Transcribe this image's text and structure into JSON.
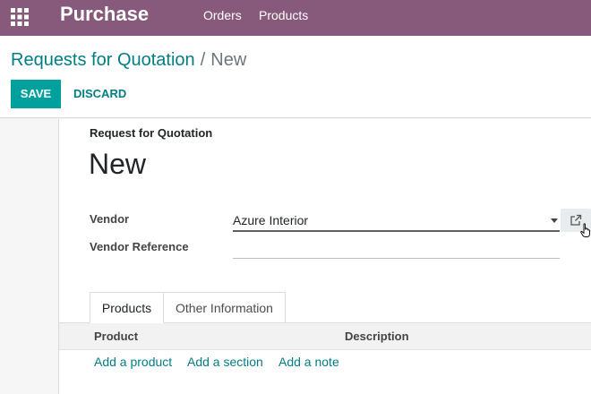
{
  "topbar": {
    "apps_icon": "grid-icon",
    "app_name": "Purchase",
    "menu": [
      "Orders",
      "Products"
    ]
  },
  "control_panel": {
    "breadcrumb": {
      "parent": "Requests for Quotation",
      "separator": "/",
      "current": "New"
    },
    "save_label": "SAVE",
    "discard_label": "DISCARD"
  },
  "form": {
    "doc_type_label": "Request for Quotation",
    "doc_name": "New",
    "fields": {
      "vendor_label": "Vendor",
      "vendor_value": "Azure Interior",
      "vendor_ref_label": "Vendor Reference",
      "vendor_ref_value": ""
    },
    "external_link_icon": "external-link-icon",
    "tabs": [
      "Products",
      "Other Information"
    ],
    "active_tab": "Products",
    "table": {
      "columns": [
        "Product",
        "Description"
      ],
      "actions": [
        "Add a product",
        "Add a section",
        "Add a note"
      ]
    }
  },
  "colors": {
    "topbar": "#875a7b",
    "primary_button": "#00a09d",
    "link": "#017e84"
  }
}
